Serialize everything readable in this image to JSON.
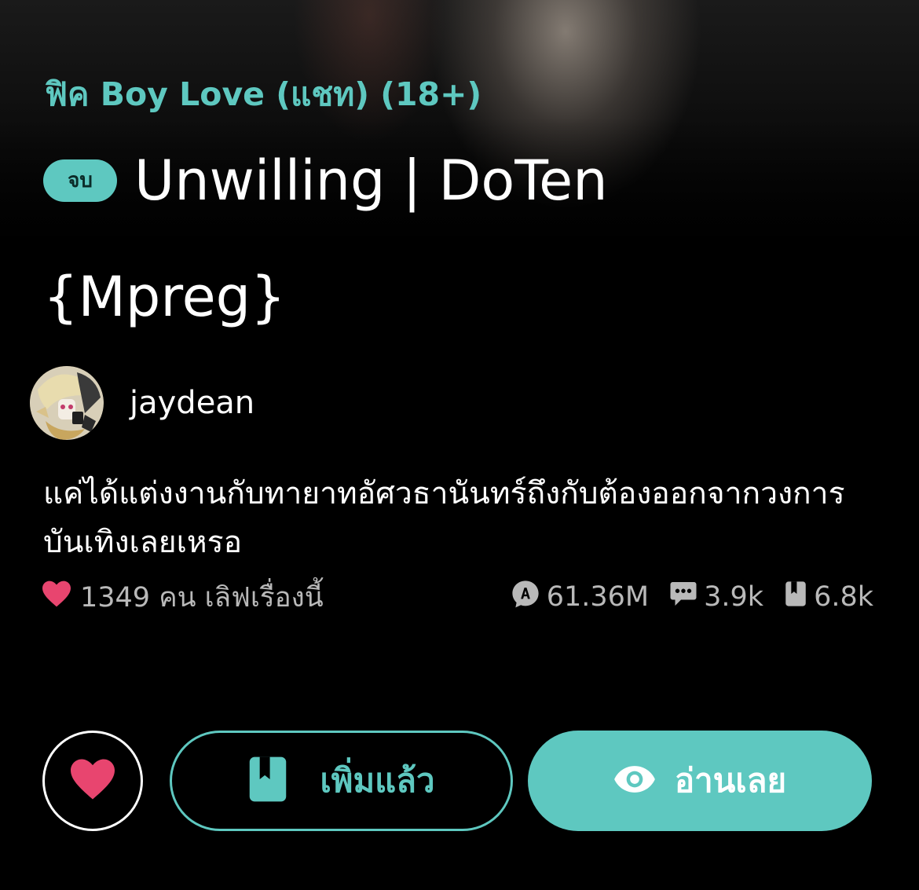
{
  "story": {
    "category": "ฟิค Boy Love (แชท) (18+)",
    "status_badge": "จบ",
    "title_line1": "Unwilling | DoTen",
    "title_line2": "{Mpreg}",
    "synopsis": "แค่ได้แต่งงานกับทายาทอัศวธานันทร์ถึงกับต้องออกจากวงการบันเทิงเลยเหรอ"
  },
  "author": {
    "name": "jaydean"
  },
  "stats": {
    "likes_text": "1349 คน เลิฟเรื่องนี้",
    "views": "61.36M",
    "comments": "3.9k",
    "bookmarks": "6.8k"
  },
  "actions": {
    "library_label": "เพิ่มแล้ว",
    "read_label": "อ่านเลย"
  },
  "colors": {
    "accent": "#5ec8c0",
    "heart": "#e8456f",
    "background": "#000000",
    "muted_text": "#b9b9b9"
  },
  "icons": {
    "status": "heart-icon",
    "views": "views-icon",
    "comments": "comment-icon",
    "bookmarks": "bookmark-icon",
    "read": "eye-icon"
  }
}
